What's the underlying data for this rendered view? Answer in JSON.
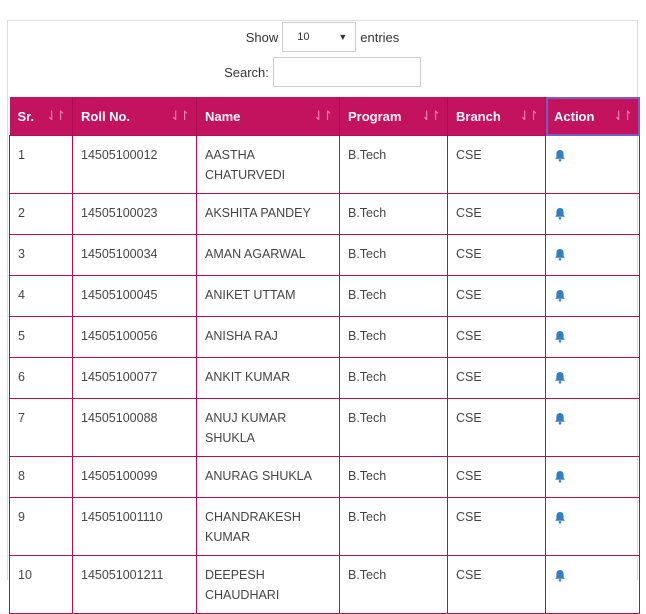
{
  "controls": {
    "show_label": "Show",
    "entries_value": "10",
    "entries_label": "entries",
    "search_label": "Search:",
    "search_value": ""
  },
  "table": {
    "headers": [
      "Sr.",
      "Roll No.",
      "Name",
      "Program",
      "Branch",
      "Action"
    ],
    "rows": [
      {
        "sr": "1",
        "roll": "14505100012",
        "name": "AASTHA CHATURVEDI",
        "program": "B.Tech",
        "branch": "CSE",
        "action_icon": "bell-icon"
      },
      {
        "sr": "2",
        "roll": "14505100023",
        "name": "AKSHITA PANDEY",
        "program": "B.Tech",
        "branch": "CSE",
        "action_icon": "bell-icon"
      },
      {
        "sr": "3",
        "roll": "14505100034",
        "name": "AMAN AGARWAL",
        "program": "B.Tech",
        "branch": "CSE",
        "action_icon": "bell-icon"
      },
      {
        "sr": "4",
        "roll": "14505100045",
        "name": "ANIKET UTTAM",
        "program": "B.Tech",
        "branch": "CSE",
        "action_icon": "bell-icon"
      },
      {
        "sr": "5",
        "roll": "14505100056",
        "name": "ANISHA RAJ",
        "program": "B.Tech",
        "branch": "CSE",
        "action_icon": "bell-icon"
      },
      {
        "sr": "6",
        "roll": "14505100077",
        "name": "ANKIT KUMAR",
        "program": "B.Tech",
        "branch": "CSE",
        "action_icon": "bell-icon"
      },
      {
        "sr": "7",
        "roll": "14505100088",
        "name": "ANUJ KUMAR SHUKLA",
        "program": "B.Tech",
        "branch": "CSE",
        "action_icon": "bell-icon"
      },
      {
        "sr": "8",
        "roll": "14505100099",
        "name": "ANURAG SHUKLA",
        "program": "B.Tech",
        "branch": "CSE",
        "action_icon": "bell-icon"
      },
      {
        "sr": "9",
        "roll": "145051001110",
        "name": "CHANDRAKESH KUMAR",
        "program": "B.Tech",
        "branch": "CSE",
        "action_icon": "bell-icon"
      },
      {
        "sr": "10",
        "roll": "145051001211",
        "name": "DEEPESH CHAUDHARI",
        "program": "B.Tech",
        "branch": "CSE",
        "action_icon": "bell-icon"
      }
    ]
  },
  "colors": {
    "header_bg": "#c3125e",
    "row_border": "#b31058",
    "bell_icon": "#2f7fc1"
  }
}
